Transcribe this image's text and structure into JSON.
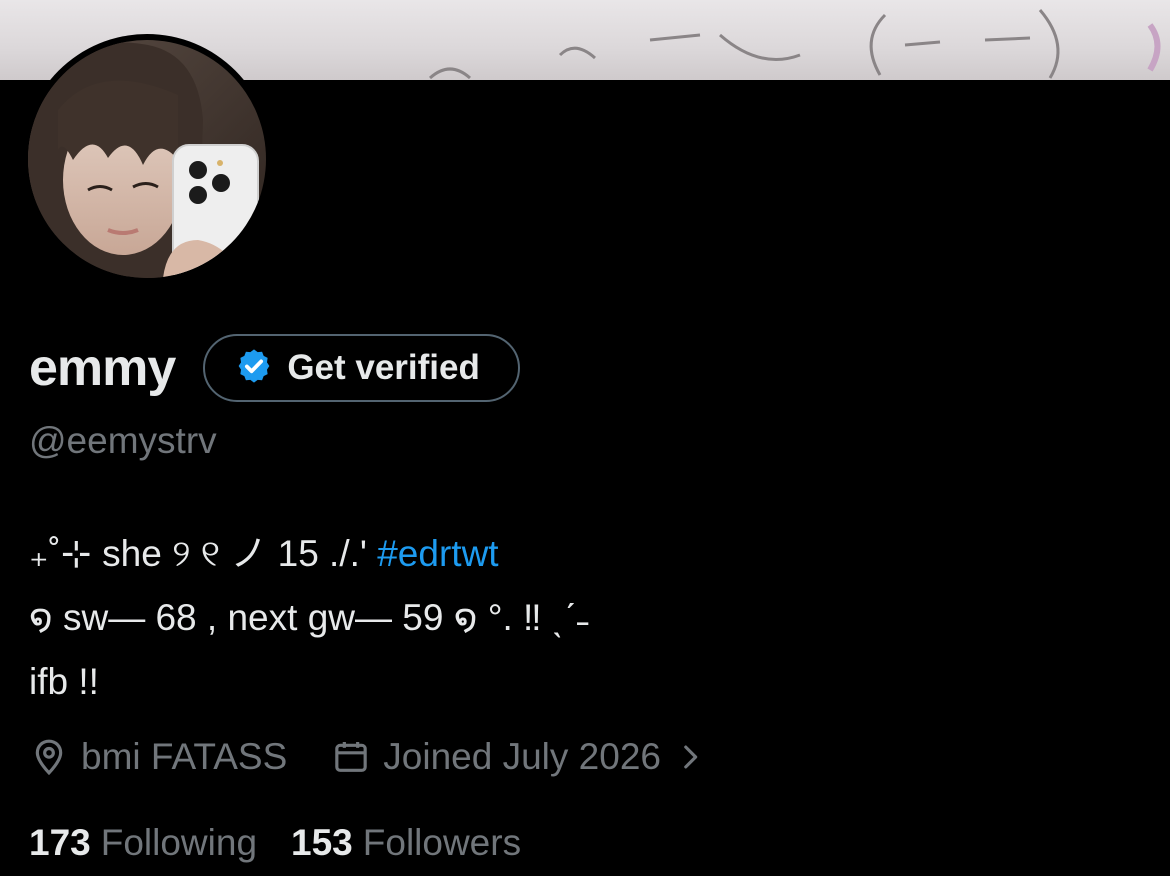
{
  "profile": {
    "display_name": "emmy",
    "handle": "@eemystrv",
    "verify_button_label": "Get verified"
  },
  "bio": {
    "line1_text": "₊˚⊹ she ୨ ୧ ノ 15 ./.' ",
    "line1_hashtag": "#edrtwt",
    "line2": "໑ sw— 68 , next gw— 59 ໑ °. ‼︎ ˎˊ˗",
    "line3": "ifb !!"
  },
  "meta": {
    "location": "bmi FATASS",
    "joined": "Joined July 2026"
  },
  "stats": {
    "following_count": "173",
    "following_label": "Following",
    "followers_count": "153",
    "followers_label": "Followers"
  },
  "icons": {
    "verified": "verified-badge-icon",
    "location": "location-pin-icon",
    "calendar": "calendar-icon",
    "chevron": "chevron-right-icon"
  },
  "colors": {
    "background": "#000000",
    "text_primary": "#e7e9ea",
    "text_secondary": "#71767b",
    "accent": "#1d9bf0",
    "border": "#536471"
  }
}
